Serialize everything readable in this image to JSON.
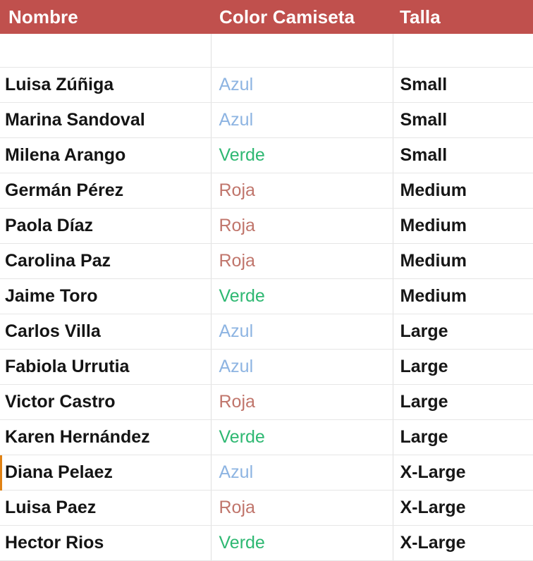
{
  "table": {
    "columns": [
      {
        "key": "nombre",
        "label": "Nombre"
      },
      {
        "key": "color",
        "label": "Color Camiseta"
      },
      {
        "key": "talla",
        "label": "Talla"
      }
    ],
    "header_background": "#c0504d",
    "header_text_color": "#ffffff",
    "gridline_color": "#e3e3e3",
    "has_empty_leading_row": true,
    "rows": [
      {
        "nombre": "Luisa Zúñiga",
        "color": "Azul",
        "talla": "Small",
        "color_hex": "#8db4e2",
        "selected": false
      },
      {
        "nombre": "Marina Sandoval",
        "color": "Azul",
        "talla": "Small",
        "color_hex": "#8db4e2",
        "selected": false
      },
      {
        "nombre": "Milena Arango",
        "color": "Verde",
        "talla": "Small",
        "color_hex": "#2eb872",
        "selected": false
      },
      {
        "nombre": "Germán Pérez",
        "color": "Roja",
        "talla": "Medium",
        "color_hex": "#c0756b",
        "selected": false
      },
      {
        "nombre": "Paola Díaz",
        "color": "Roja",
        "talla": "Medium",
        "color_hex": "#c0756b",
        "selected": false
      },
      {
        "nombre": "Carolina Paz",
        "color": "Roja",
        "talla": "Medium",
        "color_hex": "#c0756b",
        "selected": false
      },
      {
        "nombre": "Jaime Toro",
        "color": "Verde",
        "talla": "Medium",
        "color_hex": "#2eb872",
        "selected": false
      },
      {
        "nombre": "Carlos Villa",
        "color": "Azul",
        "talla": "Large",
        "color_hex": "#8db4e2",
        "selected": false
      },
      {
        "nombre": "Fabiola Urrutia",
        "color": "Azul",
        "talla": "Large",
        "color_hex": "#8db4e2",
        "selected": false
      },
      {
        "nombre": "Victor Castro",
        "color": "Roja",
        "talla": "Large",
        "color_hex": "#c0756b",
        "selected": false
      },
      {
        "nombre": "Karen Hernández",
        "color": "Verde",
        "talla": "Large",
        "color_hex": "#2eb872",
        "selected": false
      },
      {
        "nombre": "Diana Pelaez",
        "color": "Azul",
        "talla": "X-Large",
        "color_hex": "#8db4e2",
        "selected": true
      },
      {
        "nombre": "Luisa Paez",
        "color": "Roja",
        "talla": "X-Large",
        "color_hex": "#c0756b",
        "selected": false
      },
      {
        "nombre": "Hector Rios",
        "color": "Verde",
        "talla": "X-Large",
        "color_hex": "#2eb872",
        "selected": false
      }
    ]
  },
  "selection": {
    "marker_color": "#e08214",
    "row_name": "Diana Pelaez"
  }
}
